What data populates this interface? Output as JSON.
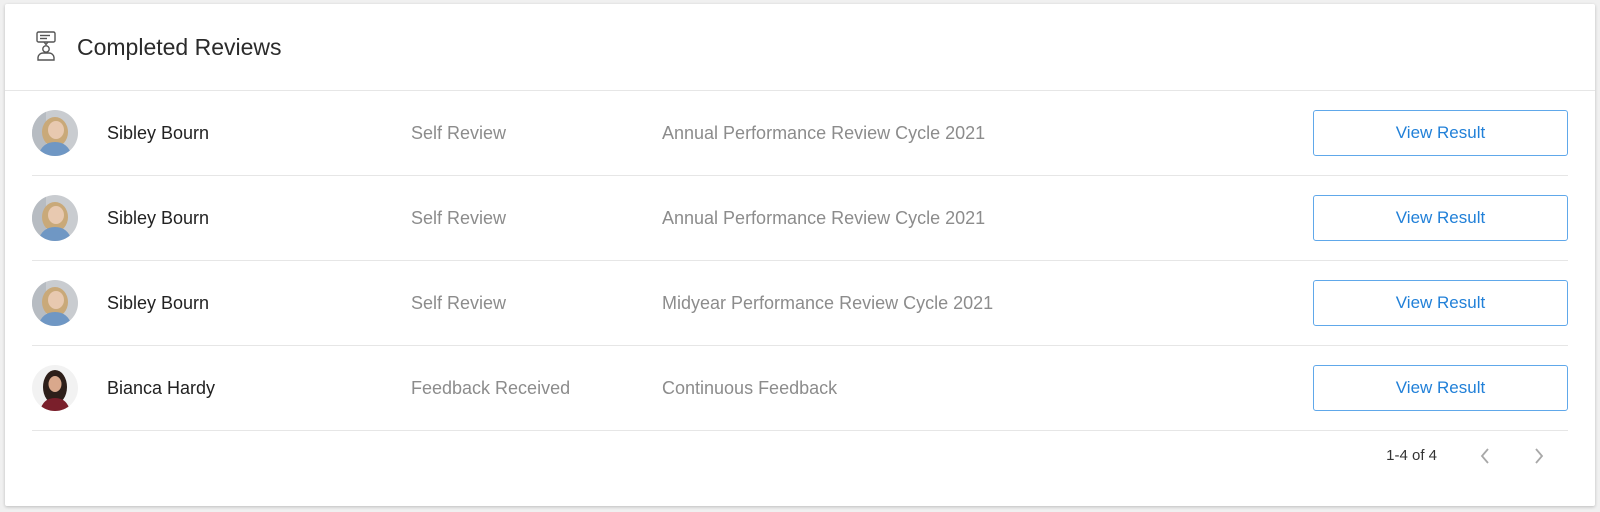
{
  "header": {
    "title": "Completed Reviews",
    "icon": "review-person-icon"
  },
  "reviews": [
    {
      "name": "Sibley Bourn",
      "type": "Self Review",
      "cycle": "Annual Performance Review Cycle 2021",
      "action": "View Result",
      "avatar": "avatar-blonde-woman"
    },
    {
      "name": "Sibley Bourn",
      "type": "Self Review",
      "cycle": "Annual Performance Review Cycle 2021",
      "action": "View Result",
      "avatar": "avatar-blonde-woman"
    },
    {
      "name": "Sibley Bourn",
      "type": "Self Review",
      "cycle": "Midyear Performance Review Cycle 2021",
      "action": "View Result",
      "avatar": "avatar-blonde-woman"
    },
    {
      "name": "Bianca Hardy",
      "type": "Feedback Received",
      "cycle": "Continuous Feedback",
      "action": "View Result",
      "avatar": "avatar-dark-hair-woman"
    }
  ],
  "pagination": {
    "range": "1-4 of 4",
    "prev_icon": "chevron-left-icon",
    "next_icon": "chevron-right-icon"
  },
  "colors": {
    "accent": "#2180d8",
    "button_border": "#60a8ea",
    "muted_text": "#8c8c8c"
  }
}
